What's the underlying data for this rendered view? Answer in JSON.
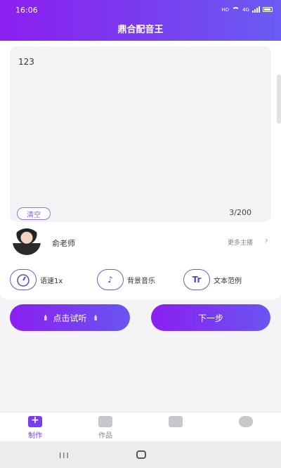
{
  "status": {
    "time": "16:06",
    "net": "HD",
    "signal": "4G"
  },
  "app": {
    "title": "鼎合配音王"
  },
  "editor": {
    "text": "123",
    "clear_label": "清空",
    "counter": "3/200"
  },
  "voice": {
    "name": "俞老师",
    "more_label": "更多主播"
  },
  "options": [
    {
      "label": "语速1x",
      "icon": "speedometer-icon"
    },
    {
      "label": "背景音乐",
      "icon": "music-note-icon",
      "glyph": "♪"
    },
    {
      "label": "文本范例",
      "icon": "text-sample-icon",
      "glyph": "Tr"
    }
  ],
  "actions": {
    "preview_label": "点击试听",
    "next_label": "下一步"
  },
  "tabs": [
    {
      "label": "制作",
      "active": true
    },
    {
      "label": "作品",
      "active": false
    }
  ],
  "colors": {
    "accent": "#8b1ff0",
    "accent2": "#6a5cf2",
    "tab_active": "#7a3cf0"
  }
}
